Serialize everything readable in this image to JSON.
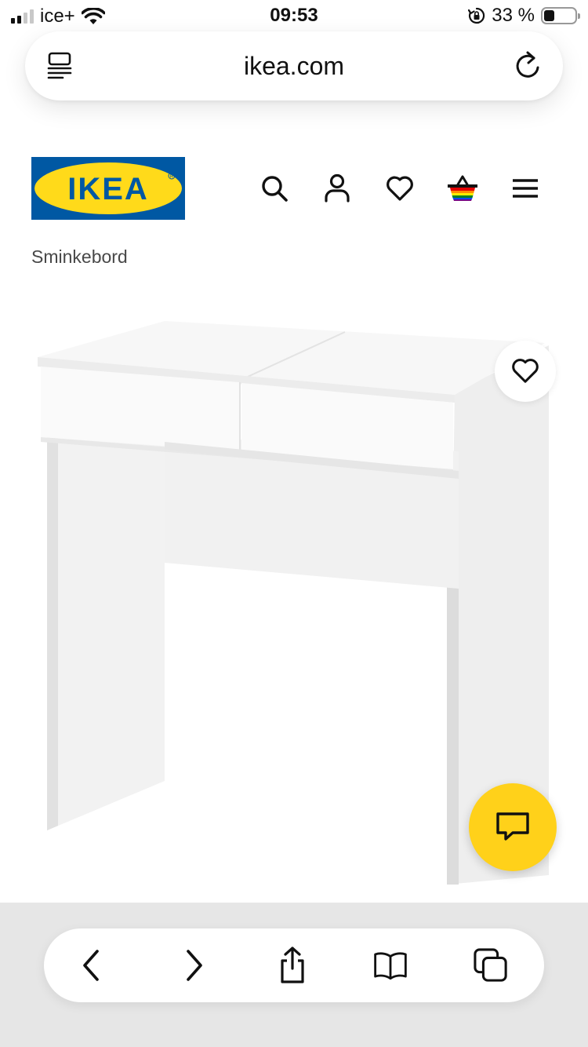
{
  "status_bar": {
    "carrier": "ice+",
    "time": "09:53",
    "battery_percent": "33 %",
    "battery_level": 0.33,
    "signal_bars_active": 2,
    "signal_bars_total": 4,
    "icons": [
      "signal-icon",
      "wifi-icon",
      "orientation-lock-icon",
      "battery-icon"
    ]
  },
  "browser": {
    "url": "ikea.com",
    "icons": {
      "left": "reader-icon",
      "right": "reload-icon"
    }
  },
  "header": {
    "logo_text": "IKEA",
    "logo_colors": {
      "background": "#0058a3",
      "ellipse": "#ffda1a",
      "text": "#0058a3"
    },
    "icons": [
      "search-icon",
      "account-icon",
      "favorites-icon",
      "cart-icon",
      "menu-icon"
    ]
  },
  "breadcrumb": {
    "label": "Sminkebord"
  },
  "product": {
    "image_icon": "white-dressing-table-image",
    "favorite_icon": "heart-icon"
  },
  "chat": {
    "icon": "chat-icon",
    "color": "#fbd914"
  },
  "toolbar": {
    "icons": [
      "back-icon",
      "forward-icon",
      "share-icon",
      "bookmarks-icon",
      "tabs-icon"
    ]
  }
}
